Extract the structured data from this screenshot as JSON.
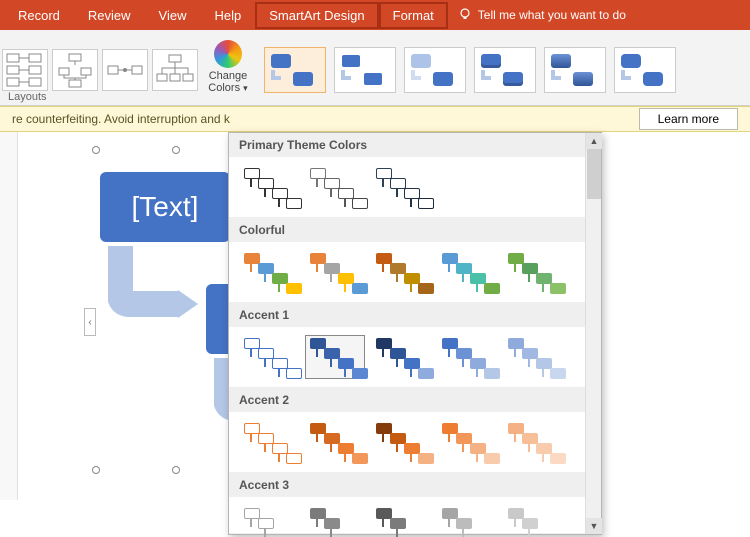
{
  "tabs": {
    "t0": "Record",
    "t1": "Review",
    "t2": "View",
    "t3": "Help",
    "t4": "SmartArt Design",
    "t5": "Format",
    "tellme": "Tell me what you want to do"
  },
  "ribbon": {
    "change_colors": "Change Colors",
    "layouts_group": "Layouts"
  },
  "msgbar": {
    "text": "re counterfeiting. Avoid interruption and k",
    "learn": "Learn more"
  },
  "smartart": {
    "placeholder": "[Text]"
  },
  "dropdown": {
    "sections": {
      "primary": "Primary Theme Colors",
      "colorful": "Colorful",
      "accent1": "Accent 1",
      "accent2": "Accent 2",
      "accent3": "Accent 3"
    }
  },
  "palettes": {
    "primary": [
      [
        "#333333",
        "#333333",
        "#333333",
        "#333333"
      ],
      [
        "#777777",
        "#666666",
        "#555555",
        "#444444"
      ],
      [
        "#2f4158",
        "#2a3a4f",
        "#243245",
        "#1d2a3a"
      ]
    ],
    "colorful": [
      [
        "#e8833a",
        "#5b9bd5",
        "#70ad47",
        "#ffc000"
      ],
      [
        "#e8833a",
        "#a5a5a5",
        "#ffc000",
        "#5b9bd5"
      ],
      [
        "#c55a11",
        "#b17a2b",
        "#bf8f00",
        "#a5651a"
      ],
      [
        "#5b9bd5",
        "#4fb5c6",
        "#4ac0a8",
        "#70ad47"
      ],
      [
        "#70ad47",
        "#57a05e",
        "#6fb36f",
        "#8cc168"
      ]
    ],
    "accent1": [
      [
        "#4472c4",
        "#4472c4",
        "#4472c4",
        "#4472c4"
      ],
      [
        "#2f5597",
        "#3a63ab",
        "#4472c4",
        "#5b86d1"
      ],
      [
        "#1f3864",
        "#2f5597",
        "#4472c4",
        "#8faadc"
      ],
      [
        "#4472c4",
        "#6a92d4",
        "#8faadc",
        "#b4c7e7"
      ],
      [
        "#8faadc",
        "#a0b8e2",
        "#b4c7e7",
        "#c8d6ee"
      ]
    ],
    "accent2": [
      [
        "#ed7d31",
        "#ed7d31",
        "#ed7d31",
        "#ed7d31"
      ],
      [
        "#c55a11",
        "#d66a20",
        "#ed7d31",
        "#f19759"
      ],
      [
        "#843c0c",
        "#c55a11",
        "#ed7d31",
        "#f4b183"
      ],
      [
        "#ed7d31",
        "#f19759",
        "#f4b183",
        "#f8cbad"
      ],
      [
        "#f4b183",
        "#f6bf98",
        "#f8cbad",
        "#fbd9c3"
      ]
    ],
    "accent3": [
      [
        "#a5a5a5",
        "#a5a5a5",
        "#a5a5a5",
        "#a5a5a5"
      ],
      [
        "#7b7b7b",
        "#8a8a8a",
        "#a5a5a5",
        "#bcbcbc"
      ],
      [
        "#595959",
        "#7b7b7b",
        "#a5a5a5",
        "#c9c9c9"
      ],
      [
        "#a5a5a5",
        "#bcbcbc",
        "#c9c9c9",
        "#d9d9d9"
      ],
      [
        "#c9c9c9",
        "#d0d0d0",
        "#d9d9d9",
        "#e5e5e5"
      ]
    ]
  }
}
